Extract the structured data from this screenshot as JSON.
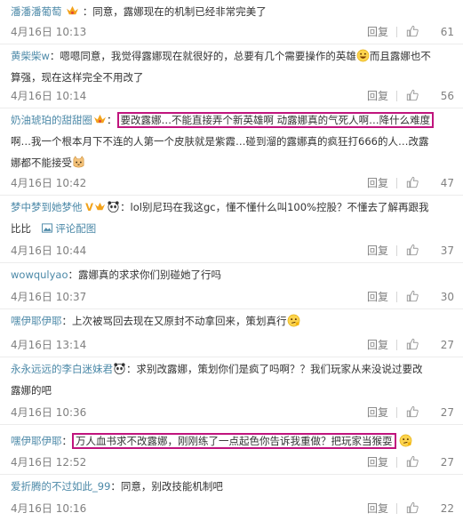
{
  "comments": [
    {
      "user": "潘潘潘葡萄",
      "text": "：同意，露娜现在的机制已经非常完美了",
      "date": "4月16日 10:13",
      "reply": "回复",
      "likes": "61"
    },
    {
      "user": "黄柴柴w",
      "text1": "：嗯嗯同意，我觉得露娜现在就很好的，总要有几个需要操作的英雄",
      "text2": "而且露娜也不",
      "text3": "算强，现在这样完全不用改了",
      "date": "4月16日 10:14",
      "reply": "回复",
      "likes": "56"
    },
    {
      "user": "奶油琥珀的甜甜圈",
      "hl": "要改露娜…不能直接弄个新英雄啊 动露娜真的气死人啊…降什么难度",
      "text2": "啊…我一个根本月下不连的人第一个皮肤就是紫霞…碰到溜的露娜真的疯狂打666的人…改露",
      "text3": "娜都不能接受",
      "date": "4月16日 10:42",
      "reply": "回复",
      "likes": "47"
    },
    {
      "user": "梦中梦到她梦他",
      "text": "：lol别尼玛在我这gc，懂不懂什么叫100%控股？不懂去了解再跟我",
      "text2": "比比",
      "pic": "评论配图",
      "date": "4月16日 10:44",
      "reply": "回复",
      "likes": "37"
    },
    {
      "user": "wowqulyao",
      "text": "：露娜真的求求你们别碰她了行吗",
      "date": "4月16日 10:37",
      "reply": "回复",
      "likes": "30"
    },
    {
      "user": "嘿伊耶伊耶",
      "text": "：上次被骂回去现在又原封不动拿回来，策划真行",
      "date": "4月16日 13:14",
      "reply": "回复",
      "likes": "27"
    },
    {
      "user": "永永远远的李白迷妹君",
      "text": "：求别改露娜，策划你们是疯了吗啊？？我们玩家从来没说过要改",
      "text2": "露娜的吧",
      "date": "4月16日 10:36",
      "reply": "回复",
      "likes": "27"
    },
    {
      "user": "嘿伊耶伊耶",
      "hl": "万人血书求不改露娜，刚刚练了一点起色你告诉我重做？把玩家当猴耍",
      "date": "4月16日 12:52",
      "reply": "回复",
      "likes": "27"
    },
    {
      "user": "爱折腾的不过如此_99",
      "text": "：同意，别改技能机制吧",
      "date": "4月16日 10:16",
      "reply": "回复",
      "likes": "22"
    }
  ]
}
